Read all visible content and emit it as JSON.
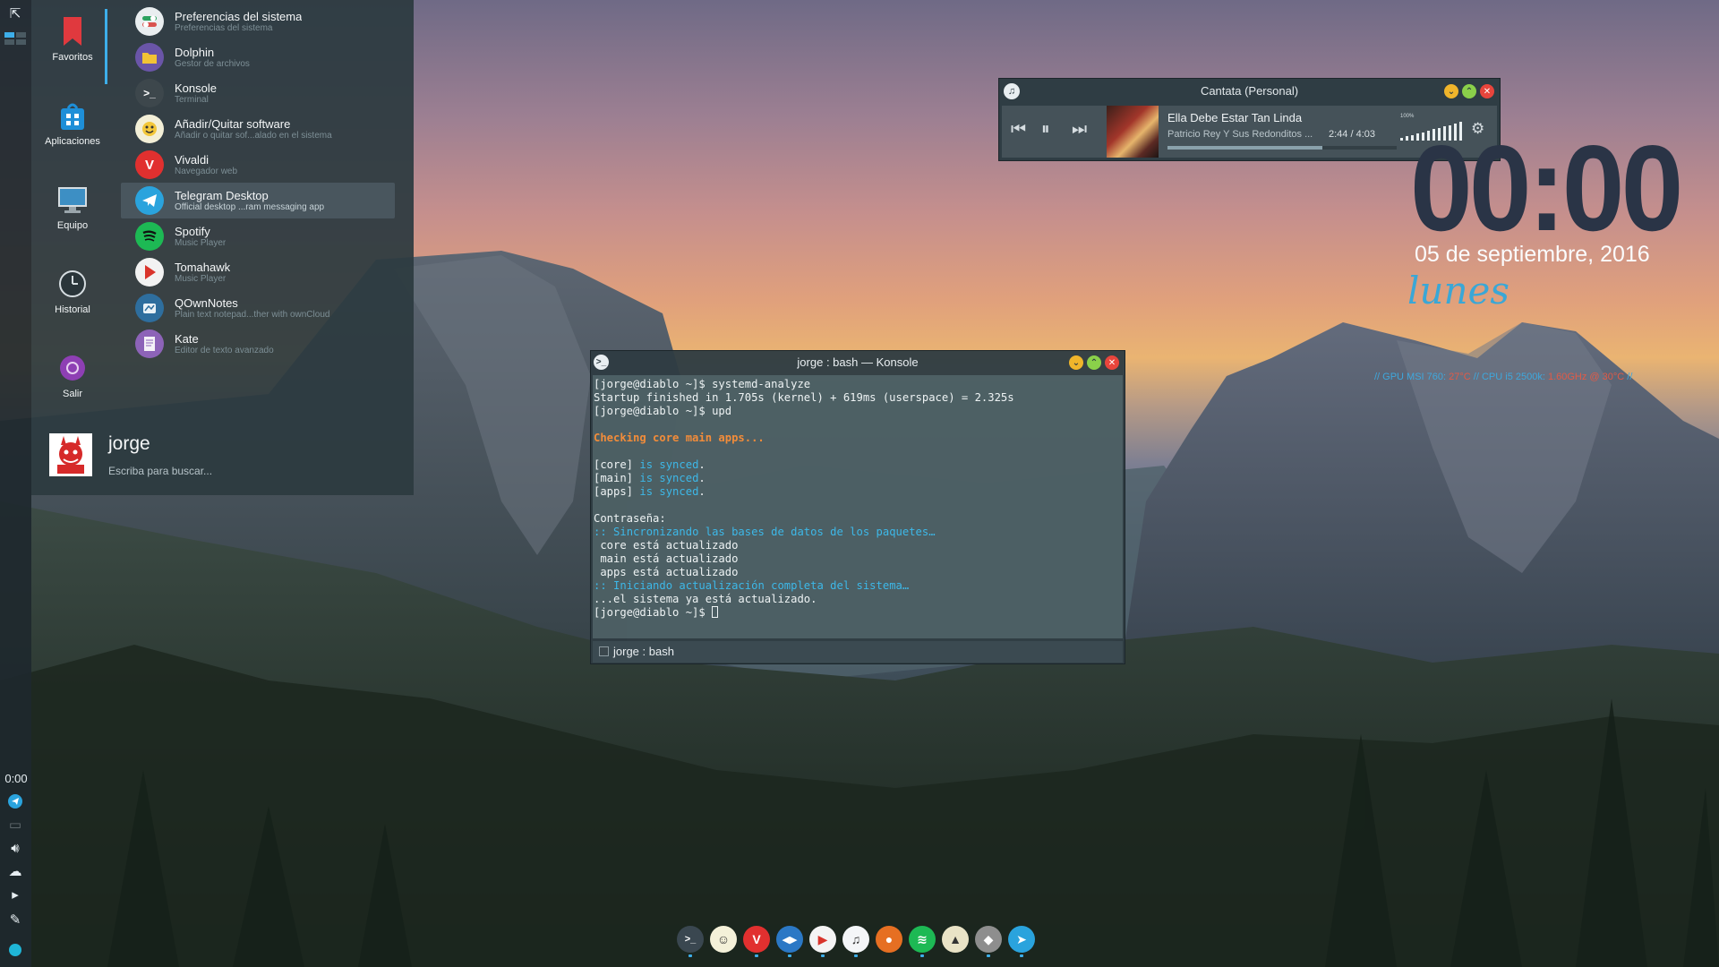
{
  "launcher": {
    "sidebar": [
      {
        "label": "Favoritos",
        "icon": "bookmark-icon"
      },
      {
        "label": "Aplicaciones",
        "icon": "applications-icon"
      },
      {
        "label": "Equipo",
        "icon": "computer-icon"
      },
      {
        "label": "Historial",
        "icon": "clock-icon"
      },
      {
        "label": "Salir",
        "icon": "power-icon"
      }
    ],
    "apps": [
      {
        "name": "Preferencias del sistema",
        "desc": "Preferencias del sistema",
        "icon": "settings-icon"
      },
      {
        "name": "Dolphin",
        "desc": "Gestor de archivos",
        "icon": "folder-icon"
      },
      {
        "name": "Konsole",
        "desc": "Terminal",
        "icon": "terminal-icon"
      },
      {
        "name": "Añadir/Quitar software",
        "desc": "Añadir o quitar sof...alado en el sistema",
        "icon": "package-icon"
      },
      {
        "name": "Vivaldi",
        "desc": "Navegador web",
        "icon": "vivaldi-icon"
      },
      {
        "name": "Telegram Desktop",
        "desc": "Official desktop ...ram messaging app",
        "icon": "telegram-icon"
      },
      {
        "name": "Spotify",
        "desc": "Music Player",
        "icon": "spotify-icon"
      },
      {
        "name": "Tomahawk",
        "desc": "Music Player",
        "icon": "tomahawk-icon"
      },
      {
        "name": "QOwnNotes",
        "desc": "Plain text notepad...ther with ownCloud",
        "icon": "notes-icon"
      },
      {
        "name": "Kate",
        "desc": "Editor de texto avanzado",
        "icon": "text-editor-icon"
      }
    ],
    "user": "jorge",
    "search_hint": "Escriba para buscar..."
  },
  "panel": {
    "clock": "0:00"
  },
  "player": {
    "window_title": "Cantata (Personal)",
    "track_title": "Ella Debe Estar Tan Linda",
    "artist": "Patricio Rey Y Sus Redonditos ...",
    "time": "2:44 / 4:03",
    "progress": 0.676,
    "volume_label": "100%",
    "volume": 1.0
  },
  "clock_widget": {
    "time": "00:00",
    "date": "05 de septiembre, 2016",
    "weekday": "lunes"
  },
  "sysinfo": {
    "gpu_label": "// GPU MSI 760:",
    "gpu_temp": "27°C",
    "cpu_label": "// CPU i5 2500k:",
    "cpu_value": "1.60GHz @ 30°C",
    "tail": "//"
  },
  "konsole": {
    "window_title": "jorge : bash — Konsole",
    "tab_label": "jorge : bash",
    "lines": [
      {
        "text": "[jorge@diablo ~]$ systemd-analyze",
        "style": ""
      },
      {
        "text": "Startup finished in 1.705s (kernel) + 619ms (userspace) = 2.325s",
        "style": ""
      },
      {
        "text": "[jorge@diablo ~]$ upd",
        "style": ""
      },
      {
        "text": "",
        "style": ""
      },
      {
        "text": "Checking core main apps...",
        "style": "orange"
      },
      {
        "text": "",
        "style": ""
      },
      {
        "text": "[core] ",
        "style": "",
        "tail": "is synced",
        "end": "."
      },
      {
        "text": "[main] ",
        "style": "",
        "tail": "is synced",
        "end": "."
      },
      {
        "text": "[apps] ",
        "style": "",
        "tail": "is synced",
        "end": "."
      },
      {
        "text": "",
        "style": ""
      },
      {
        "text": "Contraseña:",
        "style": ""
      },
      {
        "text": ":: ",
        "style": "cyanlead",
        "tail2": "Sincronizando las bases de datos de los paquetes…"
      },
      {
        "text": " core está actualizado",
        "style": ""
      },
      {
        "text": " main está actualizado",
        "style": ""
      },
      {
        "text": " apps está actualizado",
        "style": ""
      },
      {
        "text": ":: ",
        "style": "cyanlead",
        "tail2": "Iniciando actualización completa del sistema…"
      },
      {
        "text": "...el sistema ya está actualizado.",
        "style": ""
      },
      {
        "text": "[jorge@diablo ~]$ ",
        "style": "prompt"
      }
    ]
  },
  "dock": [
    {
      "icon": "terminal-icon",
      "color": "#3a4750",
      "glyph": ">_"
    },
    {
      "icon": "package-icon",
      "color": "#f4f1d9",
      "glyph": "☺"
    },
    {
      "icon": "vivaldi-icon",
      "color": "#e1302f",
      "glyph": "V"
    },
    {
      "icon": "chat-icon",
      "color": "#2b78c5",
      "glyph": "◀▶"
    },
    {
      "icon": "tomahawk-icon",
      "color": "#f4f4f4",
      "glyph": "▶"
    },
    {
      "icon": "music-icon",
      "color": "#f4f6f8",
      "glyph": "♫"
    },
    {
      "icon": "firefox-icon",
      "color": "#e66f22",
      "glyph": "●"
    },
    {
      "icon": "spotify-icon",
      "color": "#1db954",
      "glyph": "≋"
    },
    {
      "icon": "rocket-icon",
      "color": "#e9e3c6",
      "glyph": "▲"
    },
    {
      "icon": "gimp-icon",
      "color": "#8e8e8e",
      "glyph": "◆"
    },
    {
      "icon": "telegram-icon",
      "color": "#2aa3dd",
      "glyph": "➤"
    }
  ]
}
